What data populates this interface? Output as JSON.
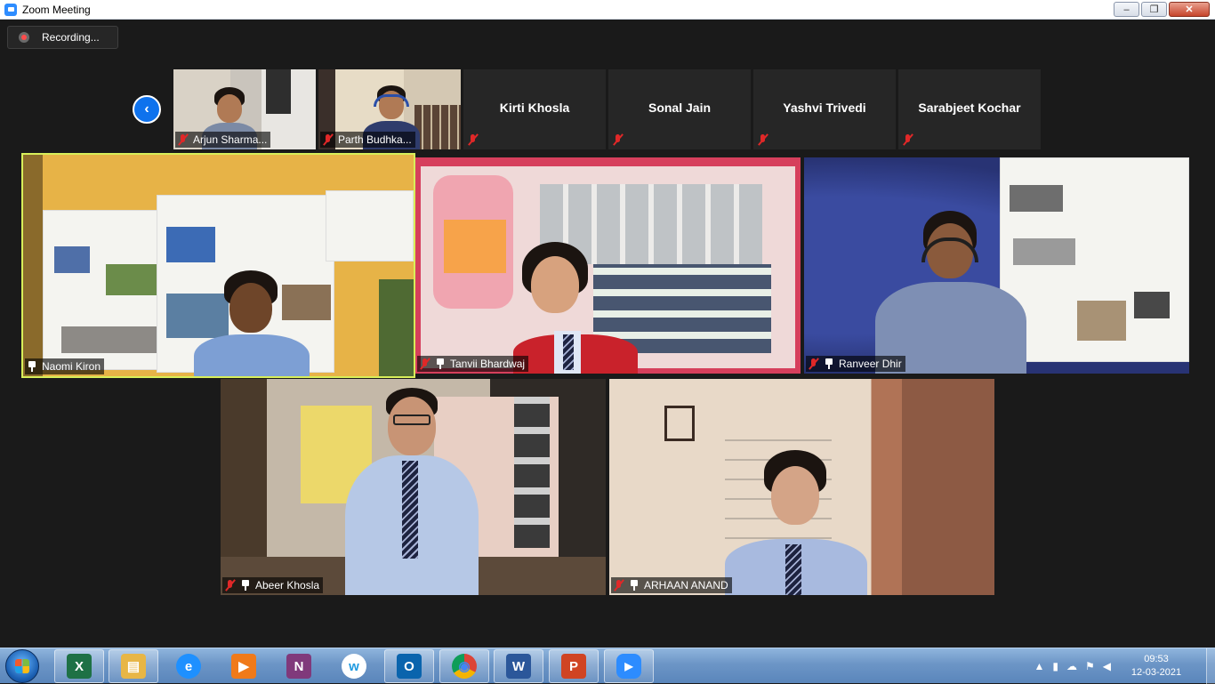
{
  "window": {
    "title": "Zoom Meeting",
    "minimize": "–",
    "restore": "❐",
    "close": "✕"
  },
  "recording": {
    "label": "Recording..."
  },
  "strip": {
    "prev_arrow": "‹",
    "thumbnails": [
      {
        "name": "Arjun Sharma...",
        "video": true
      },
      {
        "name": "Parth Budhka...",
        "video": true
      },
      {
        "name": "Kirti Khosla",
        "video": false
      },
      {
        "name": "Sonal Jain",
        "video": false
      },
      {
        "name": "Yashvi Trivedi",
        "video": false
      },
      {
        "name": "Sarabjeet Kochar",
        "video": false
      }
    ]
  },
  "gallery": [
    {
      "name": "Naomi Kiron",
      "muted": false,
      "active": true
    },
    {
      "name": "Tanvii Bhardwaj",
      "muted": true,
      "active": false
    },
    {
      "name": "Ranveer Dhir",
      "muted": true,
      "active": false
    },
    {
      "name": "Abeer Khosla",
      "muted": true,
      "active": false
    },
    {
      "name": "ARHAAN ANAND",
      "muted": true,
      "active": false
    }
  ],
  "taskbar": {
    "apps": [
      {
        "id": "excel-icon",
        "glyph": "X",
        "color": "#1e7145"
      },
      {
        "id": "file-explorer-icon",
        "glyph": "▤",
        "color": "#e8b646"
      },
      {
        "id": "internet-explorer-icon",
        "glyph": "e",
        "color": "#1e90ff"
      },
      {
        "id": "media-player-icon",
        "glyph": "▶",
        "color": "#f07a1a"
      },
      {
        "id": "onenote-icon",
        "glyph": "N",
        "color": "#80397b"
      },
      {
        "id": "webex-icon",
        "glyph": "w",
        "color": "#ffffff"
      },
      {
        "id": "outlook-icon",
        "glyph": "O",
        "color": "#0a64ad"
      },
      {
        "id": "chrome-icon",
        "glyph": "◉",
        "color": "#db4437"
      },
      {
        "id": "word-icon",
        "glyph": "W",
        "color": "#2b579a"
      },
      {
        "id": "powerpoint-icon",
        "glyph": "P",
        "color": "#d04423"
      },
      {
        "id": "zoom-icon",
        "glyph": "▶",
        "color": "#2d8cff"
      }
    ],
    "clock_time": "09:53",
    "clock_date": "12-03-2021"
  }
}
